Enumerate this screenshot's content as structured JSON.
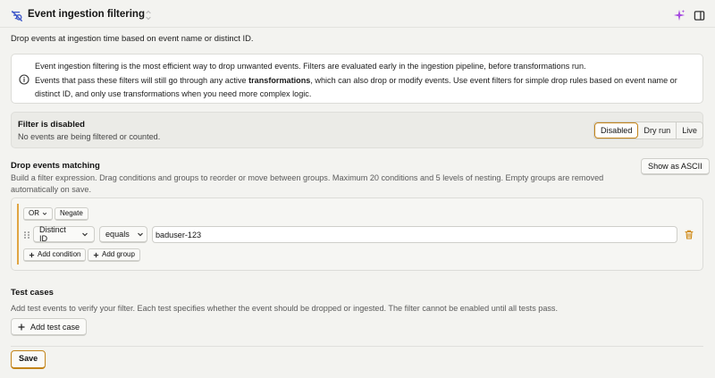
{
  "header": {
    "title": "Event ingestion filtering",
    "icon": "filter-off-icon",
    "edit_icon": "edit-pencil-icon",
    "sparkle_icon": "sparkle-icon",
    "panel_icon": "side-panel-icon"
  },
  "subtitle": "Drop events at ingestion time based on event name or distinct ID.",
  "info": {
    "icon": "info-icon",
    "line1": "Event ingestion filtering is the most efficient way to drop unwanted events. Filters are evaluated early in the ingestion pipeline, before transformations run.",
    "line2_pre": "Events that pass these filters will still go through any active ",
    "line2_bold": "transformations",
    "line2_post": ", which can also drop or modify events. Use event filters for simple drop rules based on event name or distinct ID, and only use transformations when you need more complex logic."
  },
  "status": {
    "title": "Filter is disabled",
    "subtitle": "No events are being filtered or counted.",
    "modes": [
      "Disabled",
      "Dry run",
      "Live"
    ],
    "active_mode": "Disabled"
  },
  "drop_events": {
    "title": "Drop events matching",
    "description": "Build a filter expression. Drag conditions and groups to reorder or move between groups. Maximum 20 conditions and 5 levels of nesting. Empty groups are removed automatically on save.",
    "ascii_button": "Show as ASCII",
    "group": {
      "operator": "OR",
      "negate_label": "Negate",
      "condition": {
        "property": "Distinct ID",
        "comparator": "equals",
        "value": "baduser-123"
      },
      "add_condition_label": "Add condition",
      "add_group_label": "Add group"
    }
  },
  "test_cases": {
    "title": "Test cases",
    "description": "Add test events to verify your filter. Each test specifies whether the event should be dropped or ingested. The filter cannot be enabled until all tests pass.",
    "add_label": "Add test case"
  },
  "save_label": "Save",
  "colors": {
    "accent": "#c38419",
    "trash": "#d08a14",
    "bar": "#e0a543",
    "header_icon": "#3b55c8",
    "sparkle": "#a54ae0"
  }
}
